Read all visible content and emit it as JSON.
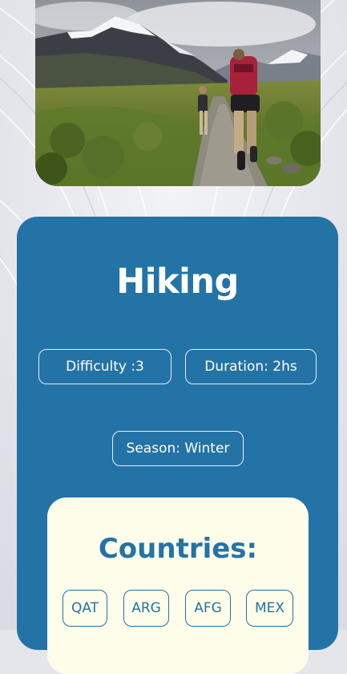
{
  "hero": {
    "image_name": "hiking-photo"
  },
  "activity": {
    "title": "Hiking",
    "difficulty": "Difficulty :3",
    "duration": "Duration: 2hs",
    "season": "Season: Winter"
  },
  "countries": {
    "title": "Countries:",
    "items": [
      "QAT",
      "ARG",
      "AFG",
      "MEX"
    ]
  },
  "colors": {
    "card": "#2473a6",
    "panel": "#fdfde9",
    "background": "#e4e6ec"
  }
}
